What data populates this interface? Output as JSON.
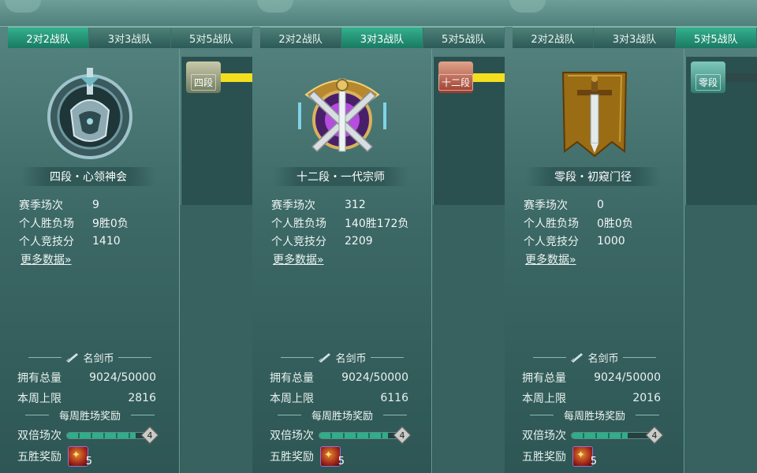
{
  "labels": {
    "season_matches": "赛季场次",
    "win_loss": "个人胜负场",
    "score": "个人竞技分",
    "more": "更多数据",
    "coin_title": "名剑币",
    "total": "拥有总量",
    "weekly_cap": "本周上限",
    "weekly_reward_title": "每周胜场奖励",
    "double": "双倍场次",
    "five_win": "五胜奖励"
  },
  "colors": {
    "tab_active": "#1f9a78",
    "rank_bar_active": "#f3df1f",
    "progress_fill": "#2fae8a"
  },
  "panels": [
    {
      "tabs": [
        "2对2战队",
        "3对3战队",
        "5对5战队"
      ],
      "active_tab": 0,
      "side_badge": "四段",
      "rank_title": "四段・心领神会",
      "emblem_icon": "silver-knight-emblem-icon",
      "season_matches": "9",
      "win_loss": "9胜0负",
      "score": "1410",
      "coin_total": "9024/50000",
      "weekly_cap": "2816",
      "double_progress": 0.85,
      "double_count": "4",
      "five_win_count": "5"
    },
    {
      "tabs": [
        "2对2战队",
        "3对3战队",
        "5对5战队"
      ],
      "active_tab": 1,
      "side_badge": "十二段",
      "rank_title": "十二段・一代宗师",
      "emblem_icon": "golden-crossed-swords-emblem-icon",
      "season_matches": "312",
      "win_loss": "140胜172负",
      "score": "2209",
      "coin_total": "9024/50000",
      "weekly_cap": "6116",
      "double_progress": 0.85,
      "double_count": "4",
      "five_win_count": "5"
    },
    {
      "tabs": [
        "2对2战队",
        "3对3战队",
        "5对5战队"
      ],
      "active_tab": 2,
      "side_badge": "零段",
      "rank_title": "零段・初窥门径",
      "emblem_icon": "banner-sword-emblem-icon",
      "season_matches": "0",
      "win_loss": "0胜0负",
      "score": "1000",
      "coin_total": "9024/50000",
      "weekly_cap": "2016",
      "double_progress": 0.7,
      "double_count": "4",
      "five_win_count": "5"
    }
  ]
}
